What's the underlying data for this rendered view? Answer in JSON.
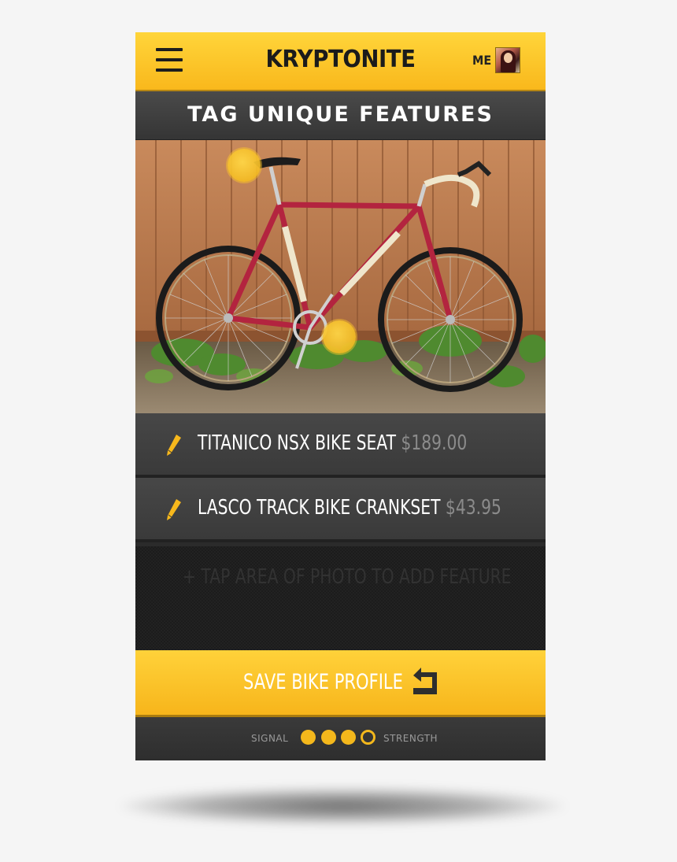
{
  "header": {
    "logo": "KRYPTONITE",
    "me_label": "ME"
  },
  "title_bar": {
    "title": "TAG UNIQUE FEATURES"
  },
  "features": [
    {
      "name": "TITANICO NSX BIKE SEAT",
      "price": "$189.00"
    },
    {
      "name": "LASCO TRACK BIKE CRANKSET",
      "price": "$43.95"
    }
  ],
  "add_feature": {
    "text": "+ TAP AREA OF PHOTO TO ADD FEATURE"
  },
  "save": {
    "label": "SAVE BIKE PROFILE",
    "icon": "return-arrow-icon"
  },
  "signal": {
    "left_label": "SIGNAL",
    "right_label": "STRENGTH",
    "level": 3,
    "max": 4
  },
  "colors": {
    "accent": "#f7b81c",
    "dark": "#2b2b2b",
    "price_gray": "#8b8b8b"
  }
}
